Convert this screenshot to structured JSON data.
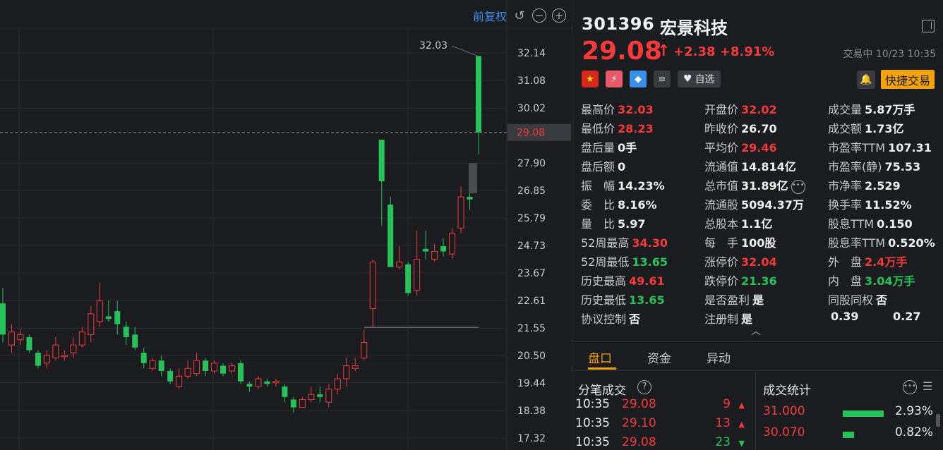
{
  "chart_panel": {
    "adjust_label": "前复权",
    "icons": [
      "reset-icon",
      "zoom-out-icon",
      "zoom-in-icon"
    ]
  },
  "chart_data": {
    "type": "candlestick",
    "y_ticks": [
      "32.14",
      "31.08",
      "30.02",
      "29.08",
      "27.90",
      "26.85",
      "25.79",
      "24.73",
      "23.67",
      "22.61",
      "21.55",
      "20.50",
      "19.44",
      "18.38",
      "17.32"
    ],
    "ylim": [
      17.32,
      32.14
    ],
    "current_price": "29.08",
    "max_label": "32.03",
    "up_color": "#f43a3a",
    "down_color": "#25c35a",
    "candles": [
      {
        "o": 22.5,
        "c": 21.3,
        "h": 23.1,
        "l": 21.0
      },
      {
        "o": 20.9,
        "c": 21.4,
        "h": 21.7,
        "l": 20.6
      },
      {
        "o": 21.1,
        "c": 21.3,
        "h": 21.5,
        "l": 20.9
      },
      {
        "o": 21.2,
        "c": 20.7,
        "h": 21.3,
        "l": 20.6
      },
      {
        "o": 20.6,
        "c": 20.1,
        "h": 20.7,
        "l": 20.0
      },
      {
        "o": 20.2,
        "c": 20.5,
        "h": 20.7,
        "l": 20.0
      },
      {
        "o": 20.4,
        "c": 20.9,
        "h": 21.2,
        "l": 20.3
      },
      {
        "o": 20.5,
        "c": 20.5,
        "h": 20.7,
        "l": 20.3
      },
      {
        "o": 20.6,
        "c": 20.9,
        "h": 21.2,
        "l": 20.4
      },
      {
        "o": 20.9,
        "c": 21.4,
        "h": 21.6,
        "l": 20.8
      },
      {
        "o": 21.3,
        "c": 22.1,
        "h": 22.4,
        "l": 21.0
      },
      {
        "o": 21.8,
        "c": 22.6,
        "h": 23.3,
        "l": 21.6
      },
      {
        "o": 22.0,
        "c": 21.9,
        "h": 22.6,
        "l": 21.8
      },
      {
        "o": 22.2,
        "c": 21.7,
        "h": 22.6,
        "l": 21.3
      },
      {
        "o": 21.6,
        "c": 21.2,
        "h": 21.8,
        "l": 20.9
      },
      {
        "o": 21.3,
        "c": 20.8,
        "h": 21.6,
        "l": 20.7
      },
      {
        "o": 20.6,
        "c": 20.2,
        "h": 20.8,
        "l": 20.0
      },
      {
        "o": 20.0,
        "c": 20.3,
        "h": 20.4,
        "l": 19.9
      },
      {
        "o": 20.3,
        "c": 19.9,
        "h": 20.5,
        "l": 19.7
      },
      {
        "o": 19.9,
        "c": 19.5,
        "h": 20.0,
        "l": 19.4
      },
      {
        "o": 19.3,
        "c": 19.7,
        "h": 20.0,
        "l": 19.2
      },
      {
        "o": 19.7,
        "c": 20.0,
        "h": 20.3,
        "l": 19.6
      },
      {
        "o": 19.8,
        "c": 20.3,
        "h": 20.6,
        "l": 19.7
      },
      {
        "o": 20.3,
        "c": 19.9,
        "h": 20.4,
        "l": 19.7
      },
      {
        "o": 19.9,
        "c": 20.2,
        "h": 20.3,
        "l": 19.8
      },
      {
        "o": 20.1,
        "c": 19.8,
        "h": 20.2,
        "l": 19.7
      },
      {
        "o": 19.9,
        "c": 20.1,
        "h": 20.2,
        "l": 19.8
      },
      {
        "o": 20.2,
        "c": 19.5,
        "h": 20.3,
        "l": 19.4
      },
      {
        "o": 19.4,
        "c": 19.3,
        "h": 19.5,
        "l": 19.1
      },
      {
        "o": 19.3,
        "c": 19.6,
        "h": 19.7,
        "l": 19.2
      },
      {
        "o": 19.5,
        "c": 19.4,
        "h": 19.6,
        "l": 19.3
      },
      {
        "o": 19.5,
        "c": 19.5,
        "h": 19.6,
        "l": 19.3
      },
      {
        "o": 19.3,
        "c": 18.9,
        "h": 19.4,
        "l": 18.7
      },
      {
        "o": 18.8,
        "c": 18.5,
        "h": 18.9,
        "l": 18.3
      },
      {
        "o": 18.5,
        "c": 18.8,
        "h": 18.9,
        "l": 18.5
      },
      {
        "o": 18.8,
        "c": 19.0,
        "h": 19.3,
        "l": 18.7
      },
      {
        "o": 19.0,
        "c": 18.9,
        "h": 19.3,
        "l": 18.7
      },
      {
        "o": 18.7,
        "c": 19.2,
        "h": 19.4,
        "l": 18.5
      },
      {
        "o": 19.2,
        "c": 19.6,
        "h": 19.8,
        "l": 19.0
      },
      {
        "o": 19.6,
        "c": 20.1,
        "h": 20.4,
        "l": 19.3
      },
      {
        "o": 20.0,
        "c": 20.1,
        "h": 20.4,
        "l": 19.9
      },
      {
        "o": 20.4,
        "c": 21.0,
        "h": 21.5,
        "l": 20.3
      },
      {
        "o": 22.3,
        "c": 24.1,
        "h": 24.2,
        "l": 21.6
      },
      {
        "o": 28.8,
        "c": 27.2,
        "h": 28.8,
        "l": 25.5
      },
      {
        "o": 26.3,
        "c": 23.9,
        "h": 26.6,
        "l": 23.9
      },
      {
        "o": 23.9,
        "c": 24.1,
        "h": 24.7,
        "l": 23.8
      },
      {
        "o": 24.0,
        "c": 22.9,
        "h": 24.1,
        "l": 22.8
      },
      {
        "o": 23.0,
        "c": 24.2,
        "h": 25.3,
        "l": 22.8
      },
      {
        "o": 24.6,
        "c": 24.5,
        "h": 25.3,
        "l": 24.2
      },
      {
        "o": 24.2,
        "c": 24.5,
        "h": 24.8,
        "l": 24.1
      },
      {
        "o": 24.7,
        "c": 24.5,
        "h": 25.0,
        "l": 24.3
      },
      {
        "o": 24.4,
        "c": 25.2,
        "h": 25.4,
        "l": 24.2
      },
      {
        "o": 25.4,
        "c": 26.6,
        "h": 27.0,
        "l": 25.2
      },
      {
        "o": 26.6,
        "c": 26.5,
        "h": 27.0,
        "l": 26.1
      },
      {
        "o": 32.02,
        "c": 29.08,
        "h": 32.03,
        "l": 28.23
      }
    ]
  },
  "quote": {
    "code": "301396",
    "name": "宏景科技",
    "price": "29.08",
    "arrow": "↑",
    "change": "+2.38 +8.91%",
    "status": "交易中 10/23 10:35",
    "favorite_label": "自选",
    "trade_button": "快捷交易",
    "stats": [
      [
        {
          "label": "最高价",
          "value": "32.03",
          "color": "red"
        },
        {
          "label": "开盘价",
          "value": "32.02",
          "color": "red"
        },
        {
          "label": "成交量",
          "value": "5.87万手",
          "color": "white"
        }
      ],
      [
        {
          "label": "最低价",
          "value": "28.23",
          "color": "red"
        },
        {
          "label": "昨收价",
          "value": "26.70",
          "color": "white"
        },
        {
          "label": "成交额",
          "value": "1.73亿",
          "color": "white"
        }
      ],
      [
        {
          "label": "盘后量",
          "value": "0手",
          "color": "white"
        },
        {
          "label": "平均价",
          "value": "29.46",
          "color": "red"
        },
        {
          "label": "市盈率TTM",
          "value": "107.31",
          "color": "white"
        }
      ],
      [
        {
          "label": "盘后额",
          "value": "0",
          "color": "white"
        },
        {
          "label": "流通值",
          "value": "14.814亿",
          "color": "white"
        },
        {
          "label": "市盈率(静)",
          "value": "75.53",
          "color": "white"
        }
      ],
      [
        {
          "label": "振　幅",
          "value": "14.23%",
          "color": "white"
        },
        {
          "label": "总市值",
          "value": "31.89亿",
          "color": "white"
        },
        {
          "label": "市净率",
          "value": "2.529",
          "color": "white"
        }
      ],
      [
        {
          "label": "委　比",
          "value": "8.16%",
          "color": "white"
        },
        {
          "label": "流通股",
          "value": "5094.37万",
          "color": "white"
        },
        {
          "label": "换手率",
          "value": "11.52%",
          "color": "white"
        }
      ],
      [
        {
          "label": "量　比",
          "value": "5.97",
          "color": "white"
        },
        {
          "label": "总股本",
          "value": "1.1亿",
          "color": "white"
        },
        {
          "label": "股息TTM",
          "value": "0.150",
          "color": "white"
        }
      ],
      [
        {
          "label": "52周最高",
          "value": "34.30",
          "color": "red"
        },
        {
          "label": "每　手",
          "value": "100股",
          "color": "white"
        },
        {
          "label": "股息率TTM",
          "value": "0.520%",
          "color": "white"
        }
      ],
      [
        {
          "label": "52周最低",
          "value": "13.65",
          "color": "green"
        },
        {
          "label": "涨停价",
          "value": "32.04",
          "color": "red"
        },
        {
          "label": "外　盘",
          "value": "2.4万手",
          "color": "red"
        }
      ],
      [
        {
          "label": "历史最高",
          "value": "49.61",
          "color": "red"
        },
        {
          "label": "跌停价",
          "value": "21.36",
          "color": "green"
        },
        {
          "label": "内　盘",
          "value": "3.04万手",
          "color": "green"
        }
      ],
      [
        {
          "label": "历史最低",
          "value": "13.65",
          "color": "green"
        },
        {
          "label": "是否盈利",
          "value": "是",
          "color": "white"
        },
        {
          "label": "同股同权",
          "value": "否",
          "color": "white"
        }
      ],
      [
        {
          "label": "协议控制",
          "value": "否",
          "color": "white"
        },
        {
          "label": "注册制",
          "value": "是",
          "color": "white"
        },
        {
          "label": "0.39",
          "value": "0.27",
          "color": "white"
        }
      ]
    ]
  },
  "tabs": [
    "盘口",
    "资金",
    "异动"
  ],
  "ticks_section": {
    "title": "分笔成交",
    "rows": [
      {
        "time": "10:35",
        "price": "29.08",
        "volume": "9",
        "dir": "up"
      },
      {
        "time": "10:35",
        "price": "29.10",
        "volume": "13",
        "dir": "up"
      },
      {
        "time": "10:35",
        "price": "29.08",
        "volume": "23",
        "dir": "down"
      }
    ]
  },
  "volume_stats": {
    "title": "成交统计",
    "rows": [
      {
        "price": "31.000",
        "pct": "2.93%",
        "share": 0.0293
      },
      {
        "price": "30.070",
        "pct": "0.82%",
        "share": 0.0082
      }
    ]
  }
}
